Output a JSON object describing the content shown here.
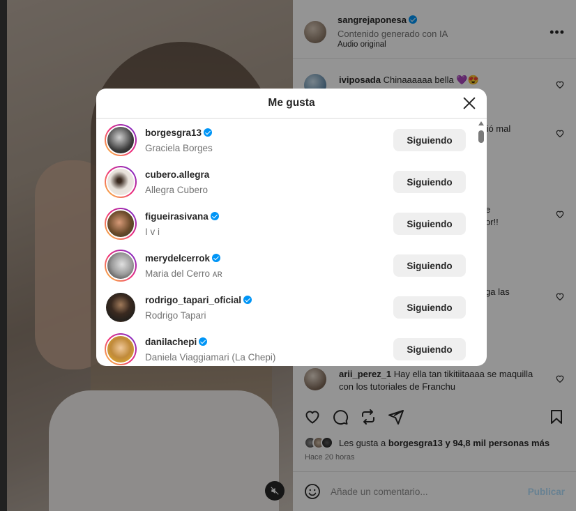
{
  "post": {
    "username": "sangrejaponesa",
    "subtitle": "Contenido generado con IA",
    "audio": "Audio original",
    "more": "•••"
  },
  "comments": [
    {
      "user": "iviposada",
      "text": "Chinaaaaaa bella 💜😍"
    },
    {
      "user": "",
      "text": "ien salió mal"
    },
    {
      "user": "",
      "text": "e"
    },
    {
      "user": "",
      "text": "or!!"
    },
    {
      "user": "",
      "text": "ga las"
    },
    {
      "user": "arii_perez_1",
      "text": "Hay ella tan tikitiitaaaa se maquilla con los tutoriales de Franchu"
    }
  ],
  "likes": {
    "text_prefix": "Les gusta a ",
    "first_user": "borgesgra13",
    "text_suffix": " y 94,8 mil personas más",
    "time_ago": "Hace 20 horas"
  },
  "comment_box": {
    "placeholder": "Añade un comentario...",
    "publish": "Publicar"
  },
  "modal": {
    "title": "Me gusta",
    "users": [
      {
        "username": "borgesgra13",
        "verified": true,
        "name": "Graciela Borges",
        "button": "Siguiendo"
      },
      {
        "username": "cubero.allegra",
        "verified": false,
        "name": "Allegra Cubero",
        "button": "Siguiendo"
      },
      {
        "username": "figueirasivana",
        "verified": true,
        "name": "I v i",
        "button": "Siguiendo"
      },
      {
        "username": "merydelcerrok",
        "verified": true,
        "name": "Maria del Cerro ᴀʀ",
        "button": "Siguiendo"
      },
      {
        "username": "rodrigo_tapari_oficial",
        "verified": true,
        "name": "Rodrigo Tapari",
        "button": "Siguiendo"
      },
      {
        "username": "danilachepi",
        "verified": true,
        "name": "Daniela Viaggiamari (La Chepi)",
        "button": "Siguiendo"
      }
    ]
  },
  "colors": {
    "verified": "#0095f6",
    "follow_button_bg": "#efefef",
    "publish": "#b2dffc"
  }
}
